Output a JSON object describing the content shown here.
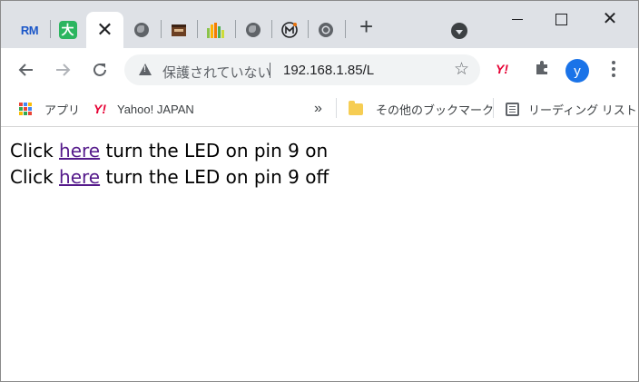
{
  "tabs": [
    {
      "icon": "rm-icon",
      "text": "RM"
    },
    {
      "icon": "green-app-icon",
      "text": "大"
    },
    {
      "icon": "close-icon",
      "active": true
    },
    {
      "icon": "globe-icon"
    },
    {
      "icon": "brown-box-icon"
    },
    {
      "icon": "bar-chart-icon"
    },
    {
      "icon": "globe-icon"
    },
    {
      "icon": "m-logo-icon"
    },
    {
      "icon": "chrome-icon"
    }
  ],
  "toolbar": {
    "security_status": "保護されていない",
    "url": "192.168.1.85/L",
    "avatar_letter": "y"
  },
  "bookmarks": {
    "apps_label": "アプリ",
    "yahoo_label": "Yahoo! JAPAN",
    "overflow": "»",
    "other_bookmarks": "その他のブックマーク",
    "reading_list": "リーディング リスト"
  },
  "page": {
    "line1": {
      "prefix": "Click ",
      "link": "here",
      "suffix": " turn the LED on pin 9 on"
    },
    "line2": {
      "prefix": "Click ",
      "link": "here",
      "suffix": " turn the LED on pin 9 off"
    }
  }
}
